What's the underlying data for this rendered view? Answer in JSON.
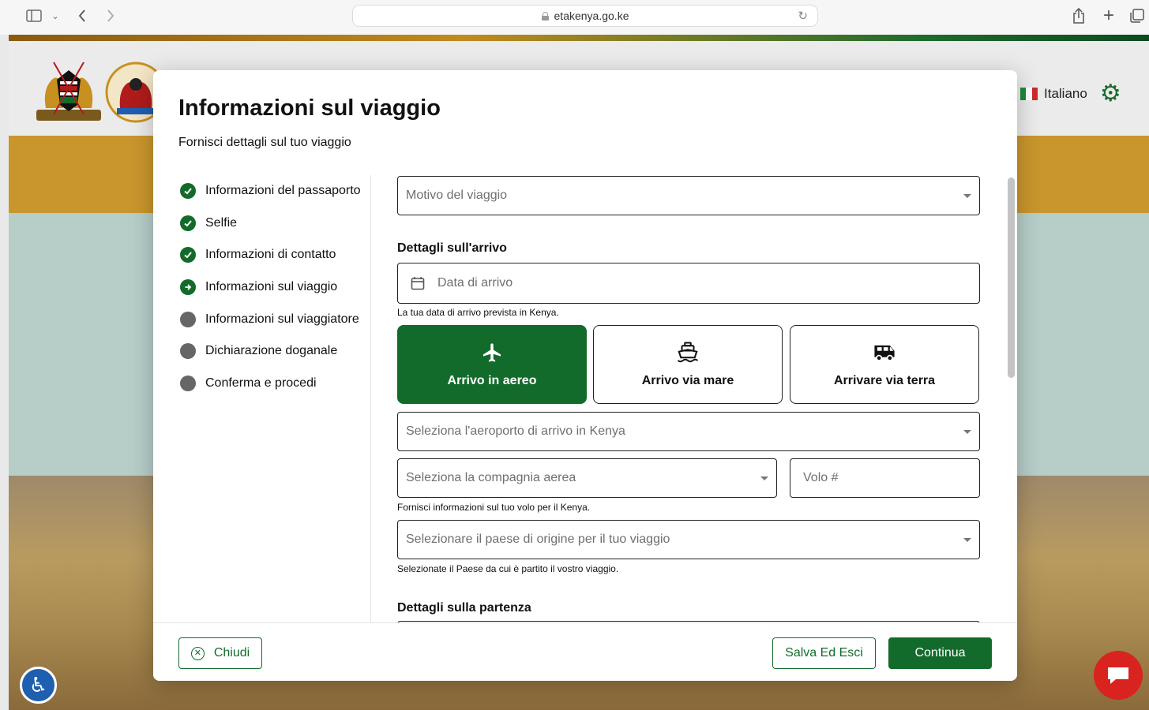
{
  "browser": {
    "url": "etakenya.go.ke"
  },
  "site": {
    "language": "Italiano"
  },
  "modal": {
    "title": "Informazioni sul viaggio",
    "subtitle": "Fornisci dettagli sul tuo viaggio"
  },
  "steps": [
    {
      "label": "Informazioni del passaporto",
      "status": "done"
    },
    {
      "label": "Selfie",
      "status": "done"
    },
    {
      "label": "Informazioni di contatto",
      "status": "done"
    },
    {
      "label": "Informazioni sul viaggio",
      "status": "current"
    },
    {
      "label": "Informazioni sul viaggiatore",
      "status": "todo"
    },
    {
      "label": "Dichiarazione doganale",
      "status": "todo"
    },
    {
      "label": "Conferma e procedi",
      "status": "todo"
    }
  ],
  "form": {
    "purpose_placeholder": "Motivo del viaggio",
    "arrival_heading": "Dettagli sull'arrivo",
    "arrival_date_placeholder": "Data di arrivo",
    "arrival_date_help": "La tua data di arrivo prevista in Kenya.",
    "modes": [
      {
        "label": "Arrivo in aereo",
        "icon": "airplane-icon",
        "selected": true
      },
      {
        "label": "Arrivo via mare",
        "icon": "ship-icon",
        "selected": false
      },
      {
        "label": "Arrivare via terra",
        "icon": "bus-icon",
        "selected": false
      }
    ],
    "airport_placeholder": "Seleziona l'aeroporto di arrivo in Kenya",
    "airline_placeholder": "Seleziona la compagnia aerea",
    "flight_placeholder": "Volo #",
    "flight_help": "Fornisci informazioni sul tuo volo per il Kenya.",
    "origin_placeholder": "Selezionare il paese di origine per il tuo viaggio",
    "origin_help": "Selezionate il Paese da cui è partito il vostro viaggio.",
    "departure_heading": "Dettagli sulla partenza"
  },
  "footer": {
    "close_label": "Chiudi",
    "save_exit_label": "Salva Ed Esci",
    "continue_label": "Continua"
  },
  "colors": {
    "primary_green": "#136b2b",
    "chat_red": "#d9231f",
    "accessibility_blue": "#1f5fb0"
  }
}
